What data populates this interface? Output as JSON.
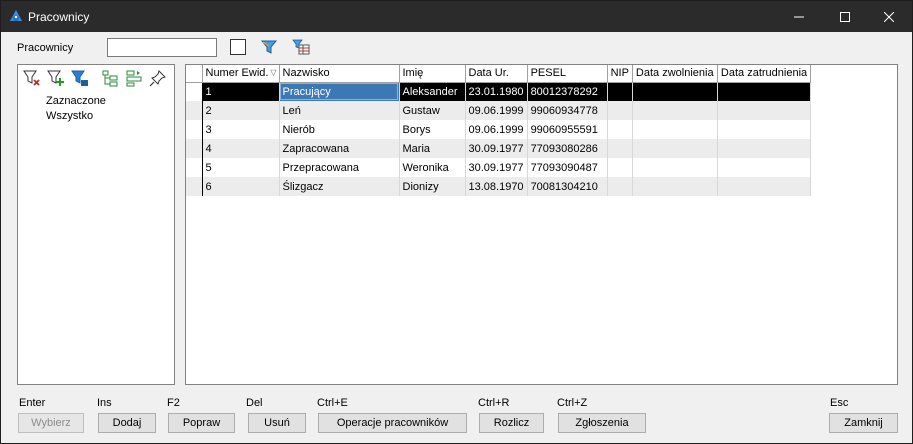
{
  "window": {
    "title": "Pracownicy"
  },
  "filter": {
    "label": "Pracownicy",
    "value": "",
    "placeholder": ""
  },
  "tree": {
    "items": [
      "Zaznaczone",
      "Wszystko"
    ]
  },
  "grid": {
    "columns": [
      "Numer Ewid.",
      "Nazwisko",
      "Imię",
      "Data Ur.",
      "PESEL",
      "NIP",
      "Data zwolnienia",
      "Data zatrudnienia"
    ],
    "rows": [
      [
        "1",
        "Pracujący",
        "Aleksander",
        "23.01.1980",
        "80012378292",
        "",
        "",
        ""
      ],
      [
        "2",
        "Leń",
        "Gustaw",
        "09.06.1999",
        "99060934778",
        "",
        "",
        ""
      ],
      [
        "3",
        "Nierób",
        "Borys",
        "09.06.1999",
        "99060955591",
        "",
        "",
        ""
      ],
      [
        "4",
        "Zapracowana",
        "Maria",
        "30.09.1977",
        "77093080286",
        "",
        "",
        ""
      ],
      [
        "5",
        "Przepracowana",
        "Weronika",
        "30.09.1977",
        "77093090487",
        "",
        "",
        ""
      ],
      [
        "6",
        "Ślizgacz",
        "Dionizy",
        "13.08.1970",
        "70081304210",
        "",
        "",
        ""
      ]
    ],
    "selected_row": 0
  },
  "actions": [
    {
      "shortcut": "Enter",
      "label": "Wybierz",
      "enabled": false
    },
    {
      "shortcut": "Ins",
      "label": "Dodaj",
      "enabled": true
    },
    {
      "shortcut": "F2",
      "label": "Popraw",
      "enabled": true
    },
    {
      "shortcut": "Del",
      "label": "Usuń",
      "enabled": true
    },
    {
      "shortcut": "Ctrl+E",
      "label": "Operacje pracowników",
      "enabled": true
    },
    {
      "shortcut": "Ctrl+R",
      "label": "Rozlicz",
      "enabled": true
    },
    {
      "shortcut": "Ctrl+Z",
      "label": "Zgłoszenia",
      "enabled": true
    },
    {
      "shortcut": "Esc",
      "label": "Zamknij",
      "enabled": true
    }
  ],
  "colors": {
    "titlebar": "#2b2b2b",
    "selected_row": "#000000",
    "focus_cell": "#3c78b4",
    "accent": "#1e6fc8"
  }
}
